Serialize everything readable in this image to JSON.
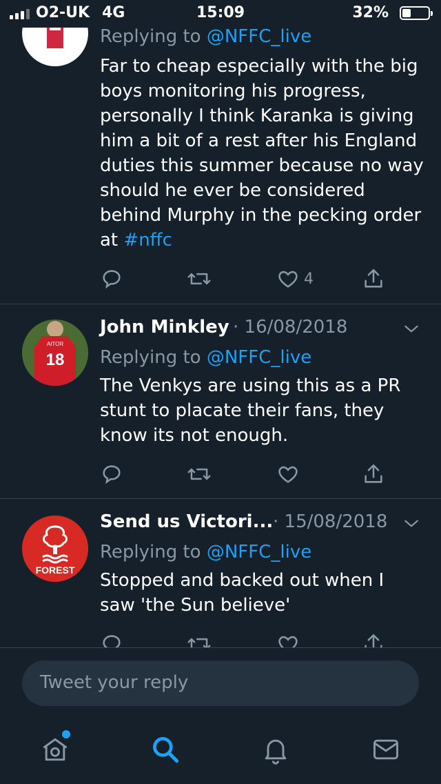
{
  "status_bar": {
    "carrier": "O2-UK",
    "network": "4G",
    "time": "15:09",
    "battery_percent": "32%"
  },
  "tweets": [
    {
      "display_name": "",
      "date": "",
      "avatar_icon": "forest-crest-avatar",
      "replying_prefix": "Replying to ",
      "replying_handle": "@NFFC_live",
      "text": "Far to cheap especially with the big boys monitoring his progress, personally I think Karanka is giving him a bit of a rest after his England duties this summer because no way should he ever be considered behind Murphy in the pecking order at ",
      "hashtag": "#nffc",
      "like_count": "4"
    },
    {
      "display_name": "John Minkley",
      "date": "· 16/08/2018",
      "avatar_icon": "football-shirt-avatar",
      "replying_prefix": "Replying to ",
      "replying_handle": "@NFFC_live",
      "text": "The Venkys are using this as a PR stunt to placate their fans, they know its not enough.",
      "like_count": ""
    },
    {
      "display_name": "Send us Victori...",
      "date": "· 15/08/2018",
      "avatar_icon": "forest-logo-avatar",
      "avatar_text": "FOREST",
      "replying_prefix": "Replying to ",
      "replying_handle": "@NFFC_live",
      "text": "Stopped and backed out when I saw 'the Sun believe'",
      "like_count": ""
    }
  ],
  "reply_bar": {
    "placeholder": "Tweet your reply"
  },
  "tab_bar": {
    "items": [
      "home-icon",
      "search-icon",
      "notifications-icon",
      "messages-icon"
    ],
    "active": "search-icon"
  },
  "colors": {
    "background": "#15202b",
    "accent": "#1da1f2",
    "secondary_text": "#8899a6",
    "divider": "#38444d"
  }
}
